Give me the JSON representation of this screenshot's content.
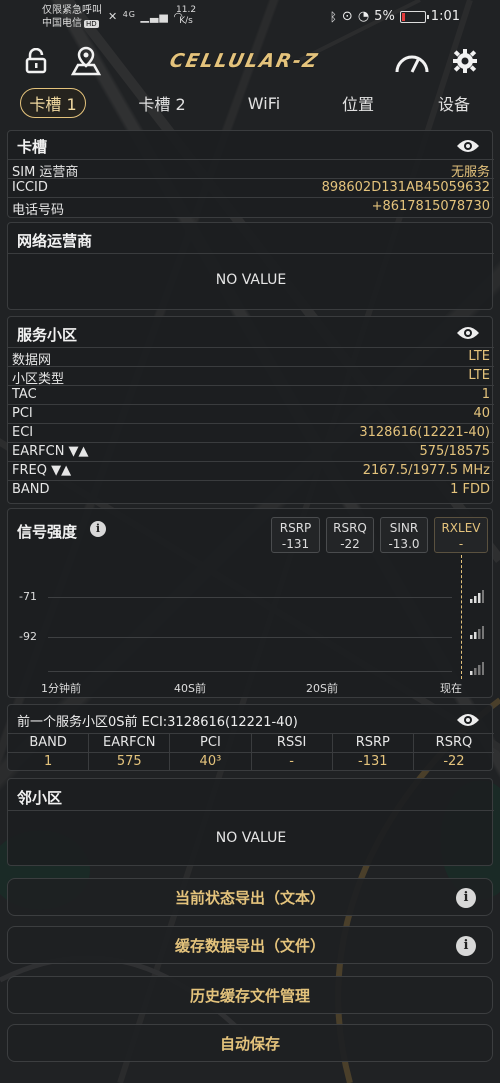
{
  "status_bar": {
    "line1": "仅限紧急呼叫",
    "line2": "中国电信",
    "hd": "HD",
    "net": "4G",
    "speed_value": "11.2",
    "speed_unit": "K/s",
    "battery": "5%",
    "time": "1:01"
  },
  "app": {
    "title": "CELLULAR-Z"
  },
  "tabs": [
    {
      "label": "卡槽 1"
    },
    {
      "label": "卡槽 2"
    },
    {
      "label": "WiFi"
    },
    {
      "label": "位置"
    },
    {
      "label": "设备"
    }
  ],
  "sim_card": {
    "title": "卡槽",
    "rows": [
      {
        "key": "SIM 运营商",
        "value": "无服务"
      },
      {
        "key": "ICCID",
        "value": "898602D131AB45059632"
      },
      {
        "key": "电话号码",
        "value": "+8617815078730"
      }
    ]
  },
  "network_operator": {
    "title": "网络运营商",
    "value": "NO VALUE"
  },
  "serving_cell": {
    "title": "服务小区",
    "rows": [
      {
        "key": "数据网",
        "value": "LTE"
      },
      {
        "key": "小区类型",
        "value": "LTE"
      },
      {
        "key": "TAC",
        "value": "1"
      },
      {
        "key": "PCI",
        "value": "40"
      },
      {
        "key": "ECI",
        "value": "3128616(12221-40)"
      },
      {
        "key": "EARFCN ▼▲",
        "value": "575/18575"
      },
      {
        "key": "FREQ ▼▲",
        "value": "2167.5/1977.5 MHz"
      },
      {
        "key": "BAND",
        "value": "1 FDD"
      }
    ]
  },
  "signal": {
    "title": "信号强度",
    "metrics": [
      {
        "name": "RSRP",
        "value": "-131"
      },
      {
        "name": "RSRQ",
        "value": "-22"
      },
      {
        "name": "SINR",
        "value": "-13.0"
      },
      {
        "name": "RXLEV",
        "value": "-"
      }
    ],
    "y_labels": [
      "-71",
      "-92"
    ],
    "x_labels": [
      "1分钟前",
      "40S前",
      "20S前",
      "现在"
    ]
  },
  "prev_cell": {
    "title": "前一个服务小区0S前 ECI:3128616(12221-40)",
    "headers": [
      "BAND",
      "EARFCN",
      "PCI",
      "RSSI",
      "RSRP",
      "RSRQ"
    ],
    "values": [
      "1",
      "575",
      "40³",
      "-",
      "-131",
      "-22"
    ]
  },
  "neighbor": {
    "title": "邻小区",
    "value": "NO VALUE"
  },
  "buttons": {
    "export_text": "当前状态导出（文本）",
    "export_file": "缓存数据导出（文件）",
    "history": "历史缓存文件管理",
    "autosave": "自动保存"
  },
  "colors": {
    "accent": "#e4c37c",
    "background": "#202224"
  }
}
